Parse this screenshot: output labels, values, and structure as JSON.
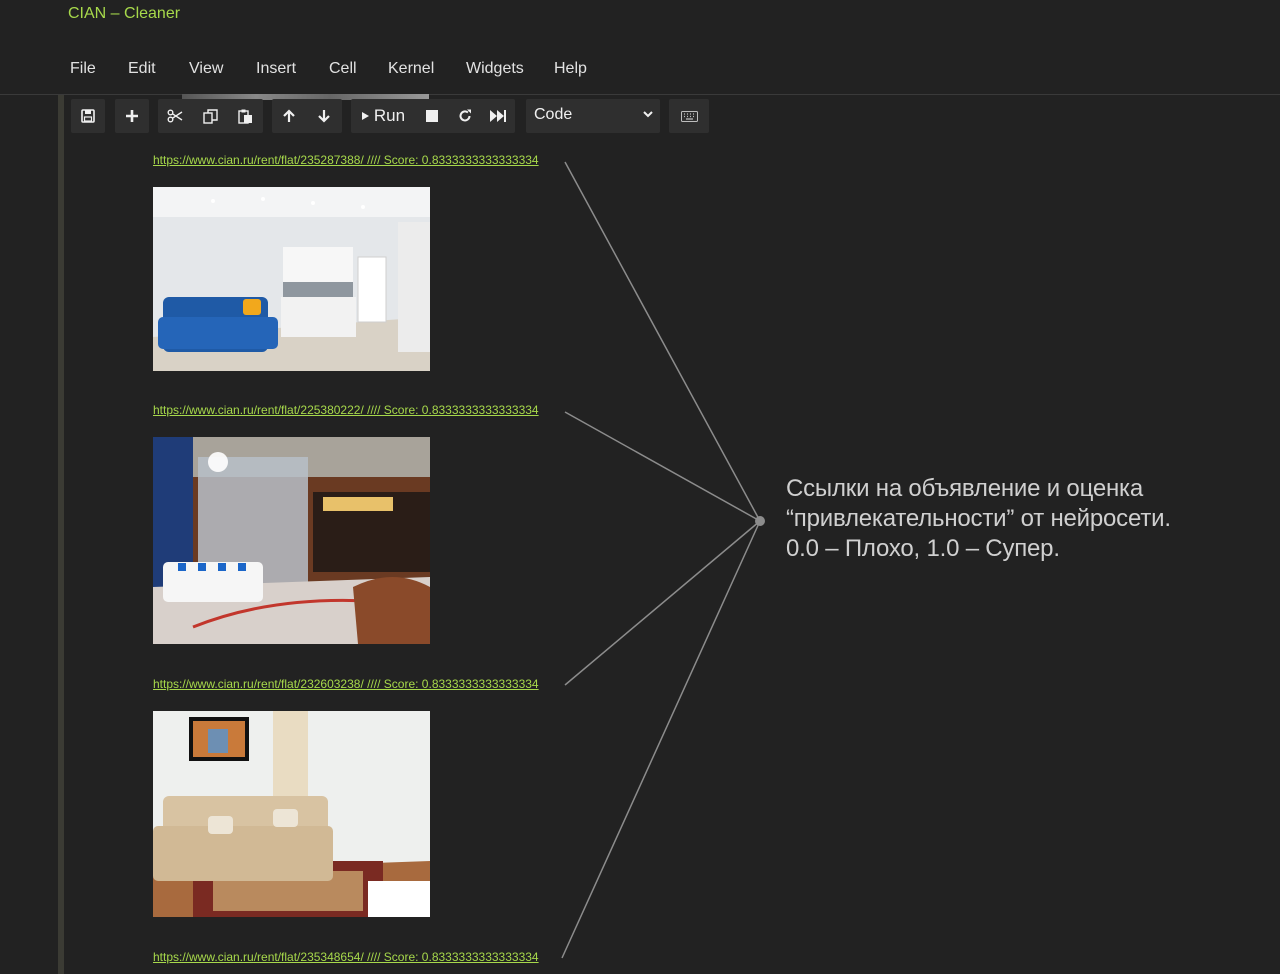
{
  "window": {
    "title": "CIAN – Cleaner"
  },
  "menu": [
    "File",
    "Edit",
    "View",
    "Insert",
    "Cell",
    "Kernel",
    "Widgets",
    "Help"
  ],
  "toolbar": {
    "icons": [
      "save-icon",
      "plus-icon",
      "scissors-icon",
      "copy-icon",
      "paste-icon",
      "arrow-up-icon",
      "arrow-down-icon",
      "run-icon",
      "stop-icon",
      "restart-icon",
      "fast-forward-icon",
      "keyboard-icon"
    ],
    "run_label": "Run",
    "cell_type": "Code"
  },
  "output": {
    "listings": [
      {
        "link": "https://www.cian.ru/rent/flat/235287388/ //// Score: 0.8333333333333334"
      },
      {
        "link": "https://www.cian.ru/rent/flat/225380222/ //// Score: 0.8333333333333334"
      },
      {
        "link": "https://www.cian.ru/rent/flat/232603238/ //// Score: 0.8333333333333334"
      },
      {
        "link": "https://www.cian.ru/rent/flat/235348654/ //// Score: 0.8333333333333334"
      }
    ]
  },
  "annotation": {
    "lines": [
      "Ссылки на объявление и оценка",
      "“привлекательности” от нейросети.",
      "0.0 – Плохо, 1.0 – Супер."
    ]
  },
  "colors": {
    "background": "#222222",
    "link": "#a7d94b",
    "toolbar": "#2f2f2f"
  }
}
